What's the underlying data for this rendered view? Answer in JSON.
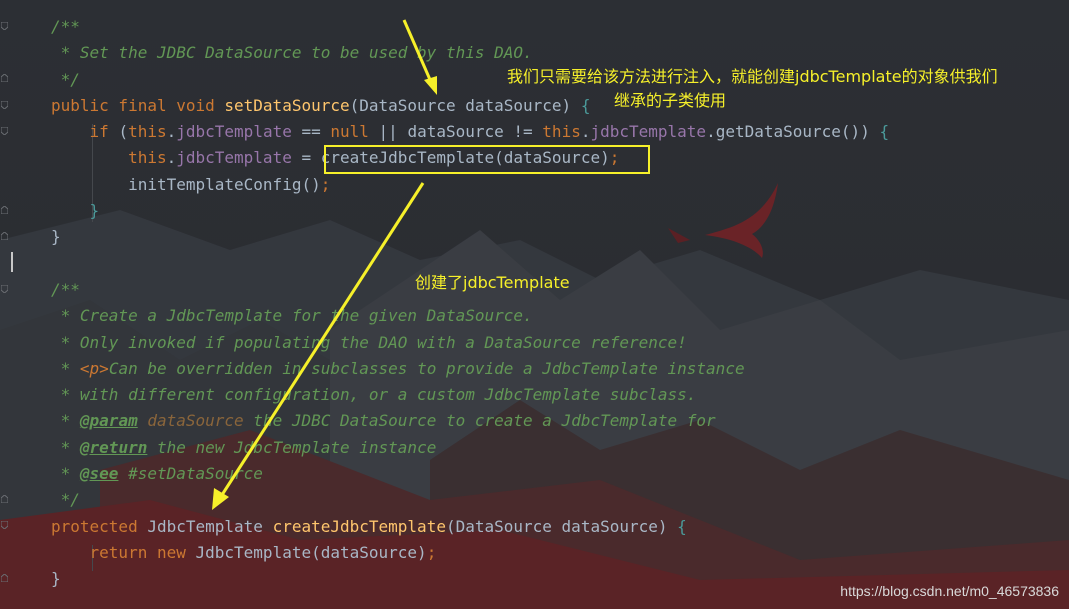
{
  "code_lines": [
    [
      {
        "t": "/**",
        "c": "cm"
      }
    ],
    [
      {
        "t": " * Set the JDBC DataSource to be used by this DAO.",
        "c": "cm"
      }
    ],
    [
      {
        "t": " */",
        "c": "cm"
      }
    ],
    [
      {
        "t": "public final void ",
        "c": "kw"
      },
      {
        "t": "setDataSource",
        "c": "fn"
      },
      {
        "t": "(DataSource dataSource) ",
        "c": ""
      },
      {
        "t": "{",
        "c": "brc"
      }
    ],
    [
      {
        "t": "    if ",
        "c": "kw"
      },
      {
        "t": "(",
        "c": ""
      },
      {
        "t": "this",
        "c": "kw"
      },
      {
        "t": ".",
        "c": ""
      },
      {
        "t": "jdbcTemplate",
        "c": "fld"
      },
      {
        "t": " == ",
        "c": ""
      },
      {
        "t": "null",
        "c": "kw"
      },
      {
        "t": " || dataSource != ",
        "c": ""
      },
      {
        "t": "this",
        "c": "kw"
      },
      {
        "t": ".",
        "c": ""
      },
      {
        "t": "jdbcTemplate",
        "c": "fld"
      },
      {
        "t": ".getDataSource()) ",
        "c": ""
      },
      {
        "t": "{",
        "c": "brc"
      }
    ],
    [
      {
        "t": "        this",
        "c": "kw"
      },
      {
        "t": ".",
        "c": ""
      },
      {
        "t": "jdbcTemplate",
        "c": "fld"
      },
      {
        "t": " = createJdbcTemplate(dataSource)",
        "c": ""
      },
      {
        "t": ";",
        "c": "kw"
      }
    ],
    [
      {
        "t": "        initTemplateConfig()",
        "c": ""
      },
      {
        "t": ";",
        "c": "kw"
      }
    ],
    [
      {
        "t": "    }",
        "c": "brc"
      }
    ],
    [
      {
        "t": "}",
        "c": ""
      }
    ],
    [
      {
        "t": "",
        "c": ""
      }
    ],
    [
      {
        "t": "/**",
        "c": "cm"
      }
    ],
    [
      {
        "t": " * Create a JdbcTemplate for the given DataSource.",
        "c": "cm"
      }
    ],
    [
      {
        "t": " * Only invoked if populating the DAO with a DataSource reference!",
        "c": "cm"
      }
    ],
    [
      {
        "t": " * ",
        "c": "cm"
      },
      {
        "t": "<p>",
        "c": "tagkw"
      },
      {
        "t": "Can be overridden in subclasses to provide a JdbcTemplate instance",
        "c": "cm"
      }
    ],
    [
      {
        "t": " * with different configuration, or a custom JdbcTemplate subclass.",
        "c": "cm"
      }
    ],
    [
      {
        "t": " * ",
        "c": "cm"
      },
      {
        "t": "@param",
        "c": "tag"
      },
      {
        "t": " ",
        "c": "cm"
      },
      {
        "t": "dataSource",
        "c": "par"
      },
      {
        "t": " the JDBC DataSource to create a JdbcTemplate for",
        "c": "cm"
      }
    ],
    [
      {
        "t": " * ",
        "c": "cm"
      },
      {
        "t": "@return",
        "c": "tag"
      },
      {
        "t": " the new JdbcTemplate instance",
        "c": "cm"
      }
    ],
    [
      {
        "t": " * ",
        "c": "cm"
      },
      {
        "t": "@see",
        "c": "tag"
      },
      {
        "t": " #setDataSource",
        "c": "cm"
      }
    ],
    [
      {
        "t": " */",
        "c": "cm"
      }
    ],
    [
      {
        "t": "protected ",
        "c": "kw"
      },
      {
        "t": "JdbcTemplate ",
        "c": ""
      },
      {
        "t": "createJdbcTemplate",
        "c": "fn"
      },
      {
        "t": "(DataSource dataSource) ",
        "c": ""
      },
      {
        "t": "{",
        "c": "brc"
      }
    ],
    [
      {
        "t": "    return new ",
        "c": "kw"
      },
      {
        "t": "JdbcTemplate(dataSource)",
        "c": ""
      },
      {
        "t": ";",
        "c": "kw"
      }
    ],
    [
      {
        "t": "}",
        "c": ""
      }
    ]
  ],
  "annotations": {
    "note1_line1": "我们只需要给该方法进行注入，就能创建jdbcTemplate的对象供我们",
    "note1_line2": "继承的子类使用",
    "note2": "创建了jdbcTemplate"
  },
  "watermark": "https://blog.csdn.net/m0_46573836",
  "colors": {
    "annotation": "#f6f02a",
    "keyword": "#cc7832",
    "comment": "#629755",
    "method": "#ffc66d",
    "field": "#9876aa",
    "background": "#2b2e33"
  }
}
